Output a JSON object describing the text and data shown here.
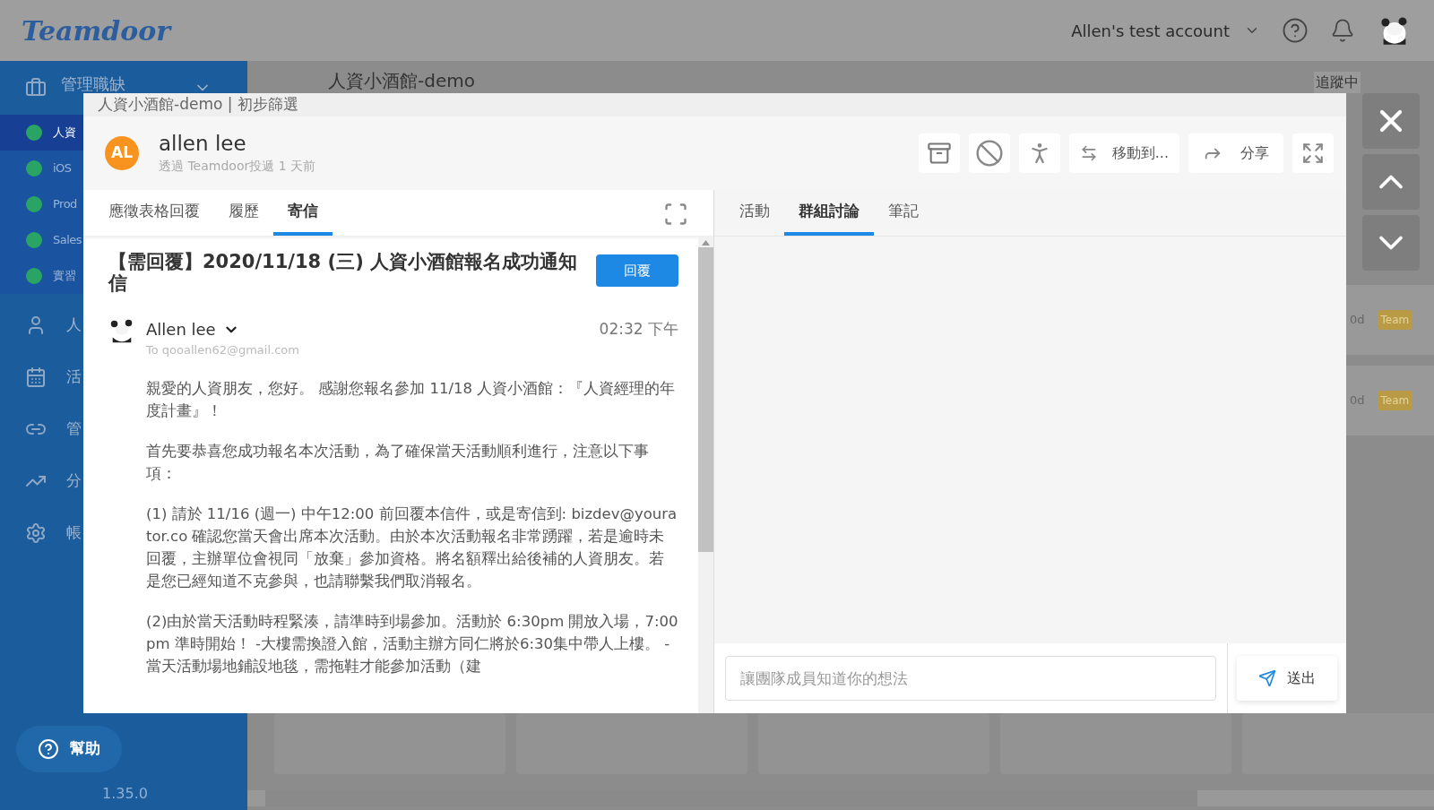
{
  "topbar": {
    "logo": "Teamdoor",
    "account": "Allen's test account"
  },
  "sidebar": {
    "section": {
      "label": "管理職缺",
      "expanded": true
    },
    "jobs": [
      {
        "label": "人資",
        "selected": true
      },
      {
        "label": "iOS",
        "selected": false
      },
      {
        "label": "Prod",
        "selected": false
      },
      {
        "label": "Sales",
        "selected": false
      },
      {
        "label": "實習",
        "selected": false
      }
    ],
    "nav": [
      {
        "label": "人",
        "kind": "user"
      },
      {
        "label": "活",
        "kind": "calendar"
      },
      {
        "label": "管",
        "kind": "link"
      },
      {
        "label": "分",
        "kind": "chart"
      },
      {
        "label": "帳",
        "kind": "gear"
      }
    ],
    "help": "幫助",
    "version": "1.35.0"
  },
  "board": {
    "title": "人資小酒館-demo",
    "follow": "追蹤中",
    "cards": [
      {
        "age": "0d",
        "tag": "Team"
      },
      {
        "age": "0d",
        "tag": "Team"
      }
    ]
  },
  "modal": {
    "breadcrumb": "人資小酒館-demo | 初步篩選",
    "candidate": {
      "initials": "AL",
      "name": "allen lee",
      "source": "透過 Teamdoor投遞 1 天前"
    },
    "actions": [
      {
        "kind": "archive"
      },
      {
        "kind": "block"
      },
      {
        "kind": "walk"
      },
      {
        "kind": "move",
        "label": "移動到..."
      },
      {
        "kind": "share",
        "label": "分享"
      },
      {
        "kind": "expand"
      }
    ],
    "left_tabs": [
      {
        "label": "應徵表格回覆",
        "selected": false
      },
      {
        "label": "履歷",
        "selected": false
      },
      {
        "label": "寄信",
        "selected": true
      }
    ],
    "email": {
      "subject": "【需回覆】2020/11/18 (三) 人資小酒館報名成功通知信",
      "reply": "回覆",
      "sender": "Allen lee",
      "to": "To qooallen62@gmail.com",
      "time": "02:32 下午",
      "paragraphs": [
        "親愛的人資朋友，您好。 感謝您報名參加 11/18 人資小酒館：『人資經理的年度計畫』！",
        "首先要恭喜您成功報名本次活動，為了確保當天活動順利進行，注意以下事項：",
        "(1) 請於 11/16 (週一) 中午12:00 前回覆本信件，或是寄信到: bizdev@yourator.co 確認您當天會出席本次活動。由於本次活動報名非常踴躍，若是逾時未回覆，主辦單位會視同「放棄」參加資格。將名額釋出給後補的人資朋友。若是您已經知道不克參與，也請聯繫我們取消報名。",
        " (2)由於當天活動時程緊湊，請準時到場參加。活動於 6:30pm 開放入場，7:00pm 準時開始！ -大樓需換證入館，活動主辦方同仁將於6:30集中帶人上樓。 -當天活動場地鋪設地毯，需拖鞋才能參加活動（建"
      ]
    },
    "right_tabs": [
      {
        "label": "活動",
        "selected": false
      },
      {
        "label": "群組討論",
        "selected": true
      },
      {
        "label": "筆記",
        "selected": false
      }
    ],
    "comment": {
      "placeholder": "讓團隊成員知道你的想法",
      "send": "送出"
    }
  }
}
